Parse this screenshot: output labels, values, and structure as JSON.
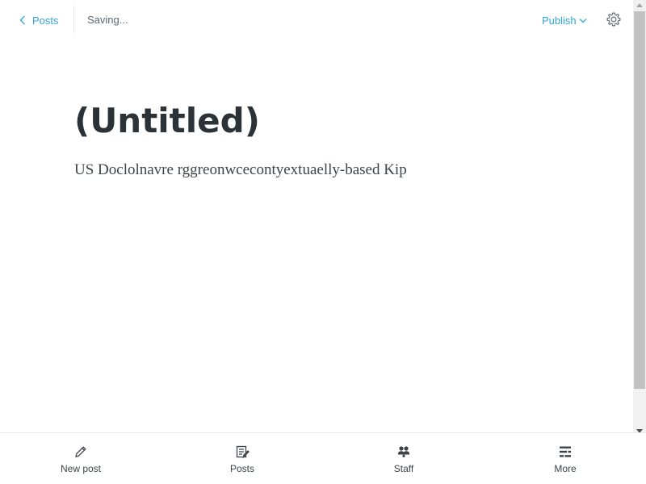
{
  "topbar": {
    "back_label": "Posts",
    "save_status": "Saving...",
    "publish_label": "Publish"
  },
  "editor": {
    "title": "(Untitled)",
    "body": "US Doclolnavre rggreonwcecontyextuaelly-based Kip"
  },
  "bottom_nav": {
    "items": [
      {
        "label": "New post",
        "icon": "pencil-icon"
      },
      {
        "label": "Posts",
        "icon": "posts-icon"
      },
      {
        "label": "Staff",
        "icon": "staff-icon"
      },
      {
        "label": "More",
        "icon": "more-icon"
      }
    ]
  },
  "colors": {
    "accent": "#2fa7d9",
    "text": "#2c3338",
    "muted": "#5b6770"
  }
}
